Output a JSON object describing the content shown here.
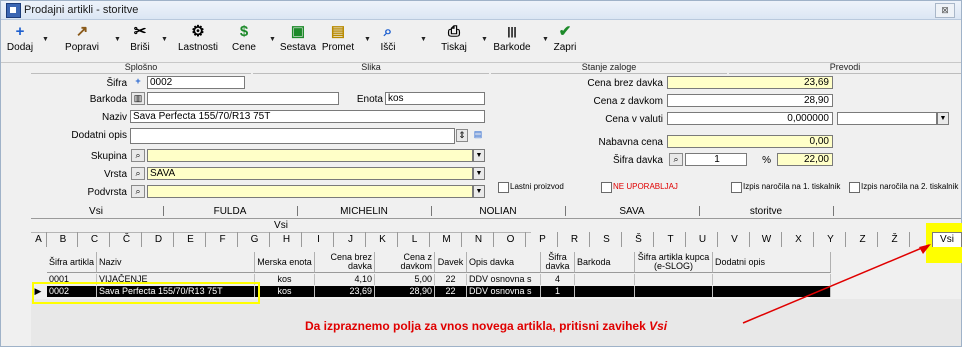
{
  "window": {
    "title": "Prodajni artikli - storitve",
    "close_label": "⊠"
  },
  "toolbar": [
    {
      "label": "Dodaj",
      "icon": "+"
    },
    {
      "label": "Popravi",
      "icon": "↗"
    },
    {
      "label": "Briši",
      "icon": "✂"
    },
    {
      "label": "Lastnosti",
      "icon": "⚙"
    },
    {
      "label": "Cene",
      "icon": "$"
    },
    {
      "label": "Sestava",
      "icon": "▣"
    },
    {
      "label": "Promet",
      "icon": "▤"
    },
    {
      "label": "Išči",
      "icon": "⌕"
    },
    {
      "label": "Tiskaj",
      "icon": "⎙"
    },
    {
      "label": "Barkode",
      "icon": "|||"
    },
    {
      "label": "Zapri",
      "icon": "✔"
    }
  ],
  "sections": {
    "splosno": "Splošno",
    "slika": "Slika",
    "stanje": "Stanje zaloge",
    "prevodi": "Prevodi"
  },
  "form": {
    "sifra_label": "Šifra",
    "sifra": "0002",
    "barkoda_label": "Barkoda",
    "barkoda": "",
    "enota_label": "Enota",
    "enota": "kos",
    "naziv_label": "Naziv",
    "naziv": "Sava Perfecta 155/70/R13 75T",
    "dodatni_label": "Dodatni opis",
    "dodatni": "",
    "skupina_label": "Skupina",
    "skupina": "",
    "vrsta_label": "Vrsta",
    "vrsta": "SAVA",
    "podvrsta_label": "Podvrsta",
    "podvrsta": ""
  },
  "prices": {
    "brez_label": "Cena brez davka",
    "brez": "23,69",
    "z_label": "Cena z davkom",
    "z": "28,90",
    "valuta_label": "Cena v valuti",
    "valuta": "0,000000",
    "nabavna_label": "Nabavna cena",
    "nabavna": "0,00",
    "davek_label": "Šifra davka",
    "davek_sifra": "1",
    "pct": "%",
    "davek": "22,00"
  },
  "checks": {
    "lastni": "Lastni proizvod",
    "ne_upo": "NE UPORABLJAJ",
    "izpis1": "Izpis naročila na 1. tiskalnik",
    "izpis2": "Izpis naročila na 2. tiskalnik"
  },
  "tabs": [
    "Vsi",
    "FULDA",
    "MICHELIN",
    "NOLIAN",
    "SAVA",
    "storitve"
  ],
  "subtab": "Vsi",
  "letters": [
    "A",
    "B",
    "C",
    "Č",
    "D",
    "E",
    "F",
    "G",
    "H",
    "I",
    "J",
    "K",
    "L",
    "M",
    "N",
    "O",
    "P",
    "R",
    "S",
    "Š",
    "T",
    "U",
    "V",
    "W",
    "X",
    "Y",
    "Z",
    "Ž"
  ],
  "vsi_tab": "Vsi",
  "table": {
    "headers": [
      "Šifra artikla",
      "Naziv",
      "Merska enota",
      "Cena brez davka",
      "Cena z davkom",
      "Davek",
      "Opis davka",
      "Šifra davka",
      "Barkoda",
      "Šifra artikla kupca (e-SLOG)",
      "Dodatni opis"
    ],
    "rows": [
      [
        "0001",
        "VIJAČENJE",
        "kos",
        "4,10",
        "5,00",
        "22",
        "DDV osnovna s",
        "4",
        "",
        "",
        ""
      ],
      [
        "0002",
        "Sava Perfecta 155/70/R13 75T",
        "kos",
        "23,69",
        "28,90",
        "22",
        "DDV osnovna s",
        "1",
        "",
        "",
        ""
      ]
    ]
  },
  "annotation": {
    "text": "Da izpraznemo polja za vnos novega artikla, pritisni zavihek ",
    "em": "Vsi"
  },
  "colors": {
    "field_yellow": "#ffffc8",
    "highlight": "#ffff00",
    "annotation": "#e00000",
    "arrow": "#e00000"
  }
}
